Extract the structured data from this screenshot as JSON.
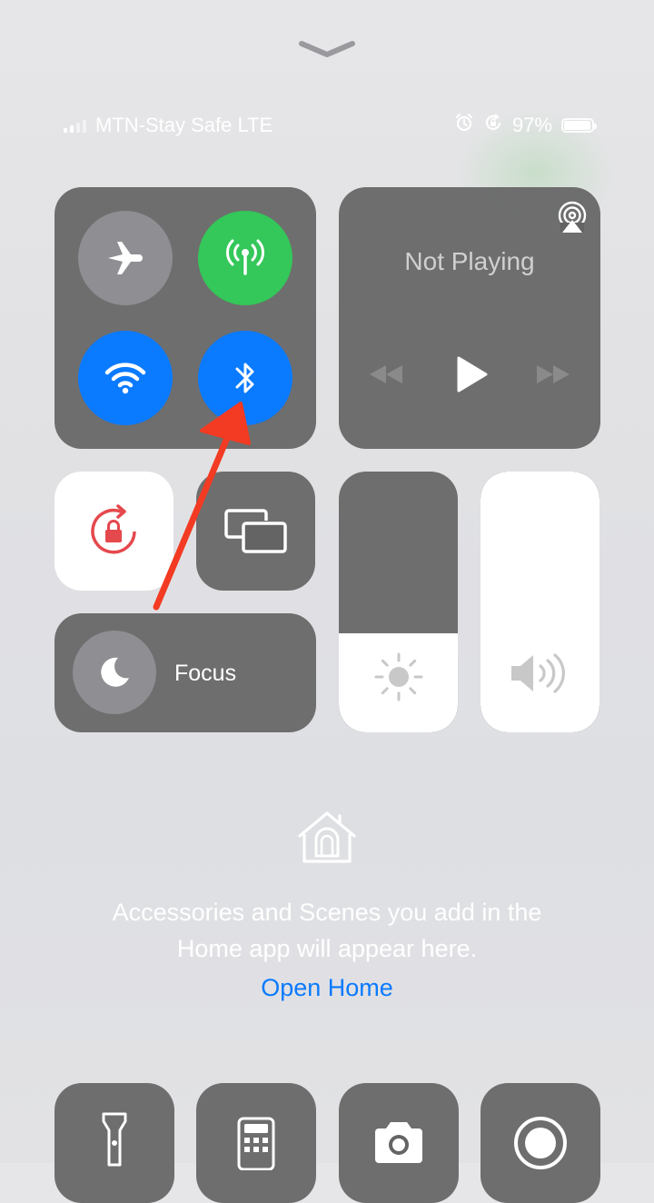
{
  "status_bar": {
    "carrier": "MTN-Stay Safe LTE",
    "battery_percent": "97%",
    "battery_level": 0.97,
    "icons": [
      "signal-icon",
      "alarm-icon",
      "rotation-lock-status-icon",
      "battery-icon"
    ]
  },
  "connectivity": {
    "airplane": {
      "icon": "airplane-icon",
      "state": "off"
    },
    "cellular": {
      "icon": "cellular-antenna-icon",
      "state": "on"
    },
    "wifi": {
      "icon": "wifi-icon",
      "state": "on"
    },
    "bluetooth": {
      "icon": "bluetooth-icon",
      "state": "on"
    }
  },
  "media": {
    "title": "Not Playing",
    "icons": [
      "airplay-icon",
      "rewind-icon",
      "play-icon",
      "fast-forward-icon"
    ]
  },
  "controls": {
    "orientation_lock": {
      "icon": "orientation-lock-icon",
      "state": "on"
    },
    "screen_mirroring": {
      "icon": "screen-mirroring-icon"
    },
    "focus": {
      "label": "Focus",
      "icon": "moon-icon"
    },
    "brightness": {
      "icon": "sun-icon",
      "level": 0.38
    },
    "volume": {
      "icon": "speaker-icon",
      "level": 1.0
    }
  },
  "home": {
    "icon": "home-icon",
    "message_line1": "Accessories and Scenes you add in the",
    "message_line2": "Home app will appear here.",
    "link": "Open Home"
  },
  "bottom_controls": [
    "flashlight-icon",
    "calculator-icon",
    "camera-icon",
    "screen-record-icon"
  ],
  "annotation": {
    "icon": "red-arrow-annotation",
    "color": "#f33a22"
  },
  "colors": {
    "accent_blue": "#0a7aff",
    "active_green": "#34c759",
    "lock_red": "#e5484d",
    "tile_gray": "#646464"
  }
}
